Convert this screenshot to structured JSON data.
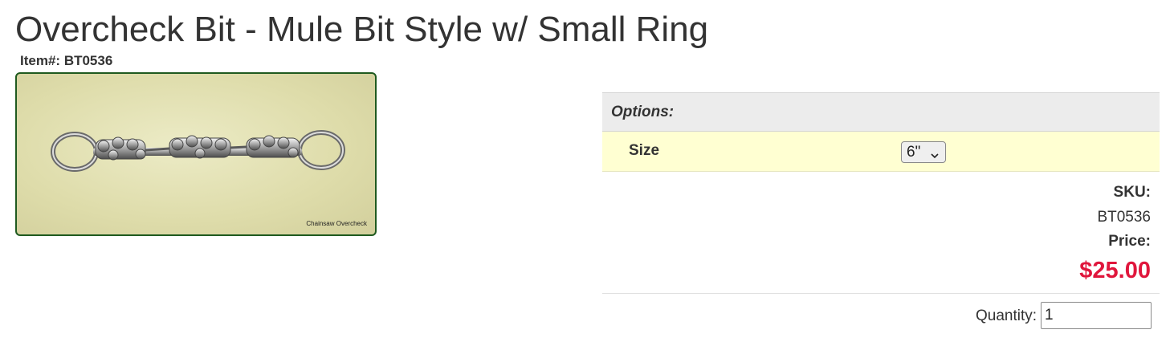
{
  "product": {
    "title": "Overcheck Bit - Mule Bit Style w/ Small Ring",
    "item_label": "Item#:",
    "item_number": "BT0536",
    "image_caption": "Chainsaw Overcheck"
  },
  "options": {
    "header": "Options:",
    "size_label": "Size",
    "size_selected": "6\""
  },
  "pricing": {
    "sku_label": "SKU:",
    "sku_value": "BT0536",
    "price_label": "Price:",
    "price_value": "$25.00"
  },
  "quantity": {
    "label": "Quantity:",
    "value": "1"
  },
  "colors": {
    "price": "#e0163c",
    "option_row_bg": "#ffffd2",
    "options_header_bg": "#ececec",
    "image_border": "#1f5a1f"
  }
}
